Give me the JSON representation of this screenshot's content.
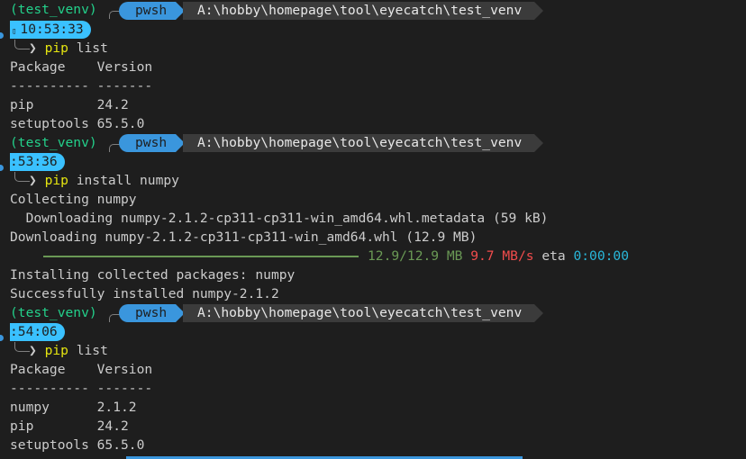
{
  "prompts": [
    {
      "venv": "(test_venv)",
      "shell": "pwsh",
      "path": "A:\\hobby\\homepage\\tool\\eyecatch\\test_venv",
      "time": "10:53:33",
      "time_icon": "clock-glyph",
      "command_name": "pip",
      "command_args": "list"
    },
    {
      "venv": "(test_venv)",
      "shell": "pwsh",
      "path": "A:\\hobby\\homepage\\tool\\eyecatch\\test_venv",
      "time": ":53:36",
      "command_name": "pip",
      "command_args": "install numpy"
    },
    {
      "venv": "(test_venv)",
      "shell": "pwsh",
      "path": "A:\\hobby\\homepage\\tool\\eyecatch\\test_venv",
      "time": ":54:06",
      "command_name": "pip",
      "command_args": "list"
    }
  ],
  "list1": {
    "header": "Package    Version",
    "sep": "---------- -------",
    "rows": [
      "pip        24.2",
      "setuptools 65.5.0"
    ]
  },
  "install": {
    "collecting": "Collecting numpy",
    "downloading_meta": "  Downloading numpy-2.1.2-cp311-cp311-win_amd64.whl.metadata (59 kB)",
    "downloading": "Downloading numpy-2.1.2-cp311-cp311-win_amd64.whl (12.9 MB)",
    "progress_size": "12.9/12.9 MB",
    "progress_speed": "9.7 MB/s",
    "progress_eta_label": "eta",
    "progress_eta": "0:00:00",
    "progress_fraction": 1.0,
    "installing": "Installing collected packages: numpy",
    "success": "Successfully installed numpy-2.1.2"
  },
  "list2": {
    "header": "Package    Version",
    "sep": "---------- -------",
    "rows": [
      "numpy      2.1.2",
      "pip        24.2",
      "setuptools 65.5.0"
    ]
  },
  "colors": {
    "background": "#1e1e1e",
    "venv_green": "#23d18b",
    "shell_segment_blue": "#3a96dd",
    "path_segment_gray": "#3b3b3b",
    "time_segment_cyan": "#3ac1ff",
    "command_yellow": "#e5e510",
    "progress_green": "#6a9955",
    "speed_red": "#f14c4c",
    "eta_cyan": "#29b8db"
  }
}
